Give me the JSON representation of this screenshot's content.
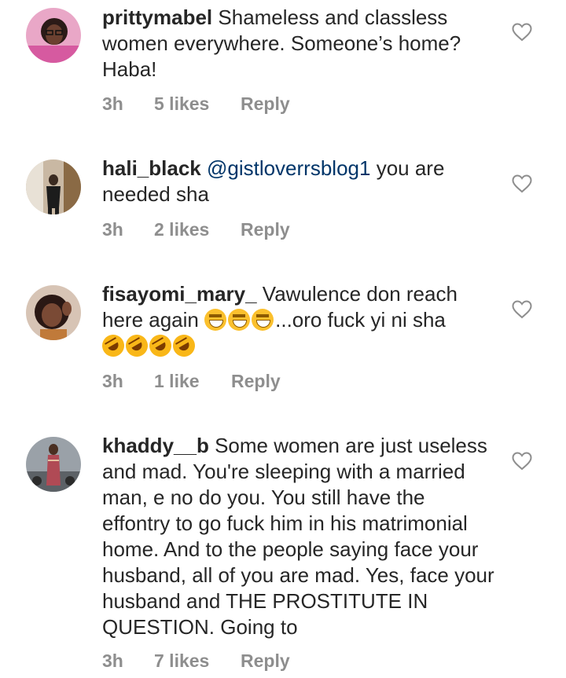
{
  "comments": [
    {
      "username": "prittymabel",
      "text": "Shameless and classless women everywhere. Someone’s home? Haba!",
      "time": "3h",
      "likes": "5 likes",
      "reply": "Reply"
    },
    {
      "username": "hali_black",
      "mention": "@gistloverrsblog1",
      "text": "you are needed sha",
      "time": "3h",
      "likes": "2 likes",
      "reply": "Reply"
    },
    {
      "username": "fisayomi_mary_",
      "text_before": "Vawulence don reach here again",
      "text_after": "...oro fuck yi ni sha",
      "emoji_grin": "grinning-squinting-face",
      "emoji_rofl": "rolling-on-the-floor-laughing",
      "time": "3h",
      "likes": "1 like",
      "reply": "Reply"
    },
    {
      "username": "khaddy__b",
      "text": "Some women are just useless and mad. You're sleeping with a married man, e no do you. You still have the effontry to go fuck him in his matrimonial home. And to the people saying face your husband, all of you are mad. Yes, face your husband and THE PROSTITUTE IN QUESTION. Going to",
      "time": "3h",
      "likes": "7 likes",
      "reply": "Reply"
    }
  ],
  "icons": {
    "like": "heart-outline-icon"
  },
  "colors": {
    "text": "#262626",
    "meta": "#8e8e8e",
    "mention": "#003569"
  }
}
